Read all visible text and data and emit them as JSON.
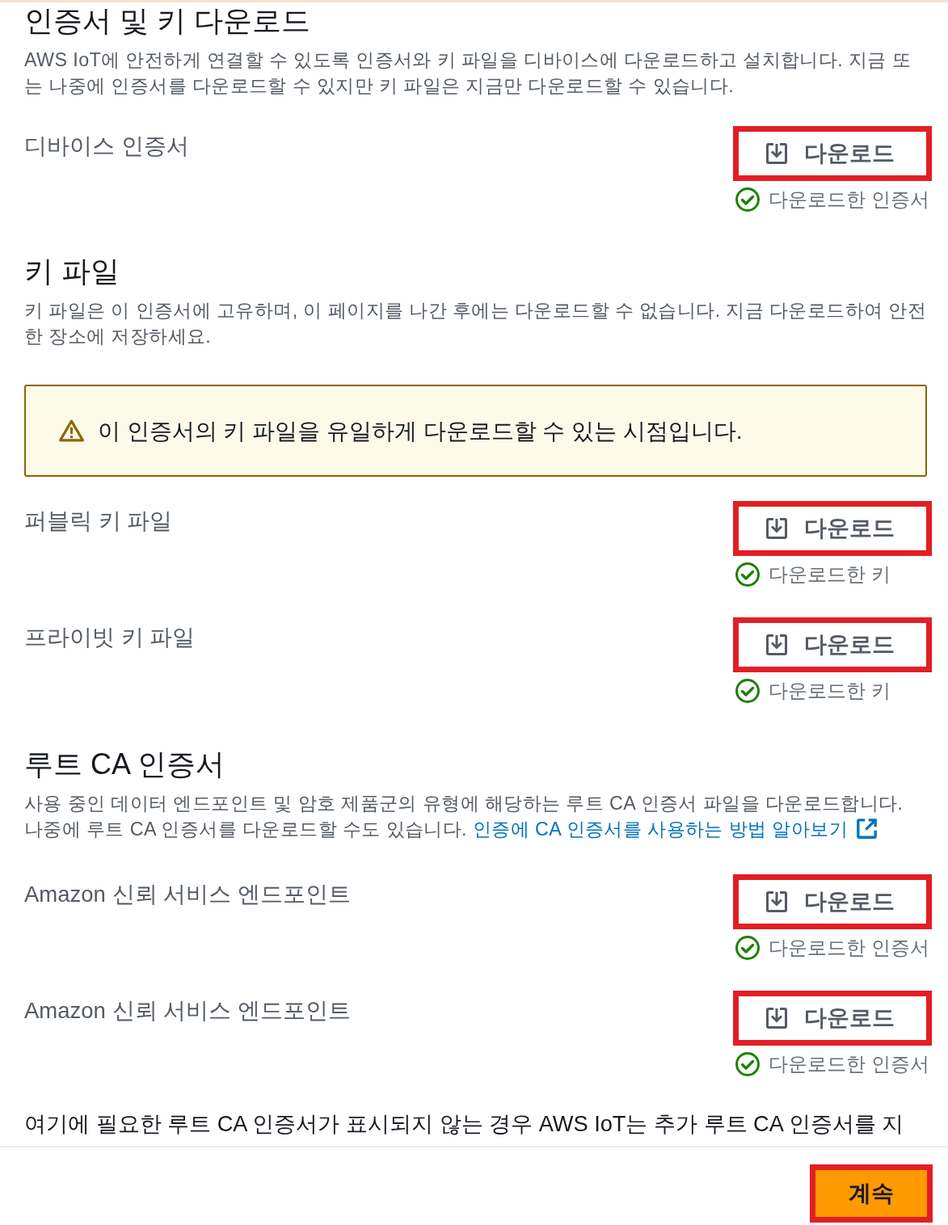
{
  "sections": [
    {
      "heading": "인증서 및 키 다운로드",
      "description": "AWS IoT에 안전하게 연결할 수 있도록 인증서와 키 파일을 디바이스에 다운로드하고 설치합니다. 지금 또는 나중에 인증서를 다운로드할 수 있지만 키 파일은 지금만 다운로드할 수 있습니다.",
      "items": [
        {
          "label": "디바이스 인증서",
          "download_button": {
            "label": "다운로드",
            "highlighted": true
          },
          "status": {
            "text": "다운로드한 인증서",
            "success": true
          }
        }
      ]
    },
    {
      "heading": "키 파일",
      "description": "키 파일은 이 인증서에 고유하며, 이 페이지를 나간 후에는 다운로드할 수 없습니다. 지금 다운로드하여 안전한 장소에 저장하세요.",
      "alert": {
        "kind": "warning",
        "text": "이 인증서의 키 파일을 유일하게 다운로드할 수 있는 시점입니다."
      },
      "items": [
        {
          "label": "퍼블릭 키 파일",
          "download_button": {
            "label": "다운로드",
            "highlighted": true
          },
          "status": {
            "text": "다운로드한 키",
            "success": true
          }
        },
        {
          "label": "프라이빗 키 파일",
          "download_button": {
            "label": "다운로드",
            "highlighted": true
          },
          "status": {
            "text": "다운로드한 키",
            "success": true
          }
        }
      ]
    },
    {
      "heading": "루트 CA 인증서",
      "description": "사용 중인 데이터 엔드포인트 및 암호 제품군의 유형에 해당하는 루트 CA 인증서 파일을 다운로드합니다. 나중에 루트 CA 인증서를 다운로드할 수도 있습니다.",
      "link": {
        "text": "인증에 CA 인증서를 사용하는 방법 알아보기",
        "external": true
      },
      "items": [
        {
          "label": "Amazon 신뢰 서비스 엔드포인트",
          "download_button": {
            "label": "다운로드",
            "highlighted": true
          },
          "status": {
            "text": "다운로드한 인증서",
            "success": true
          }
        },
        {
          "label": "Amazon 신뢰 서비스 엔드포인트",
          "download_button": {
            "label": "다운로드",
            "highlighted": true
          },
          "status": {
            "text": "다운로드한 인증서",
            "success": true
          }
        }
      ],
      "note": "여기에 필요한 루트 CA 인증서가 표시되지 않는 경우 AWS IoT는 추가 루트 CA 인증서를 지"
    }
  ],
  "footer": {
    "continue_button": {
      "label": "계속",
      "highlighted": true
    }
  }
}
